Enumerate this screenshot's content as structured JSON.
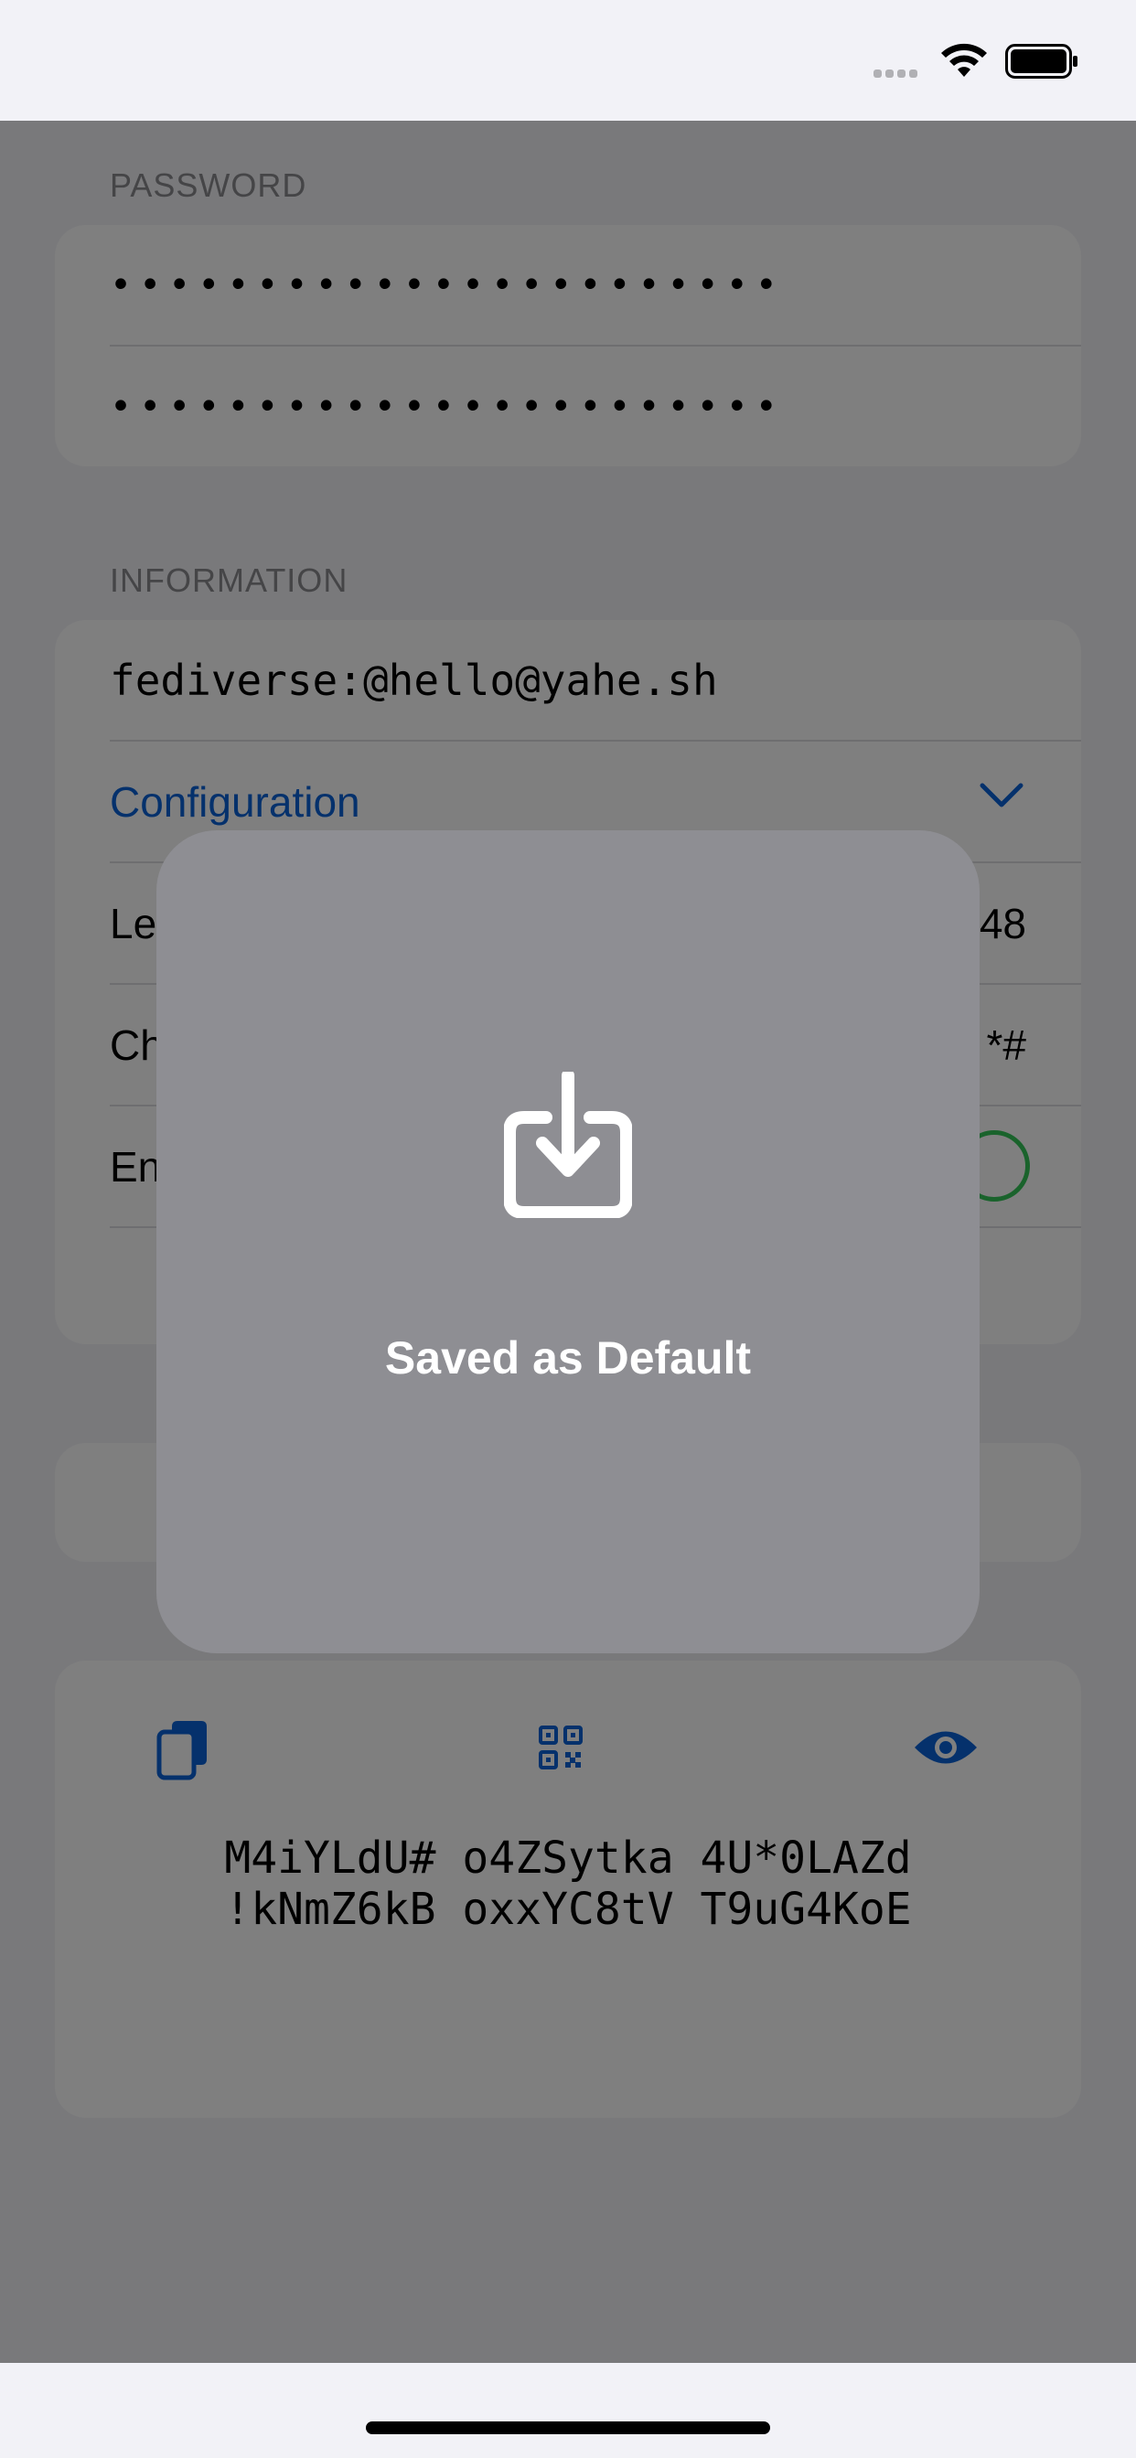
{
  "status_bar": {
    "signal_icon": "signal-dots-icon",
    "wifi_icon": "wifi-icon",
    "battery_icon": "battery-icon"
  },
  "password_section": {
    "header": "PASSWORD",
    "field1_dots": "•••••••••••••••••••••••",
    "field2_dots": "•••••••••••••••••••••••"
  },
  "information_section": {
    "header": "INFORMATION",
    "identifier": "fediverse:@hello@yahe.sh",
    "configuration_label": "Configuration",
    "configuration_icon": "chevron-down-icon",
    "length_label": "Le",
    "length_value": "48",
    "characters_label": "Ch",
    "characters_value": "*#",
    "enable_label": "En"
  },
  "actions": {
    "copy_icon": "copy-icon",
    "qr_icon": "qrcode-icon",
    "eye_icon": "eye-icon"
  },
  "generated_password": {
    "line1": "M4iYLdU# o4ZSytka 4U*0LAZd",
    "line2": "!kNmZ6kB oxxYC8tV T9uG4KoE"
  },
  "hud": {
    "icon": "save-download-icon",
    "message": "Saved as Default"
  },
  "colors": {
    "accent": "#0a63d8",
    "toggle_on": "#34c759",
    "hud_bg": "#8e8e93"
  }
}
